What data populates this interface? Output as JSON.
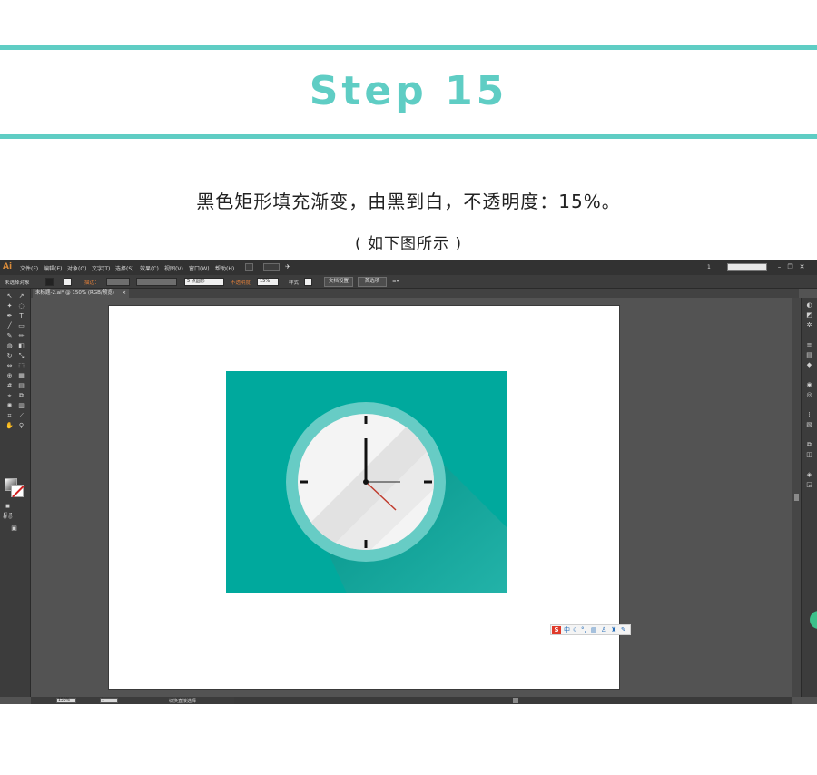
{
  "header": {
    "title": "Step 15",
    "description": "黑色矩形填充渐变，由黑到白，不透明度：15%。",
    "subtitle": "( 如下图所示 )"
  },
  "colors": {
    "accent": "#5fcdc4",
    "canvas_teal": "#00a99d",
    "clock_ring": "#67ccc5",
    "clock_face": "#f4f4f4",
    "second_hand": "#c0392b"
  },
  "app": {
    "logo": "Ai",
    "menu": [
      "文件(F)",
      "编辑(E)",
      "对象(O)",
      "文字(T)",
      "选择(S)",
      "效果(C)",
      "视图(V)",
      "窗口(W)",
      "帮助(H)"
    ],
    "workspace_label": "1",
    "control": {
      "selection_label": "未选择对象",
      "stroke_label": "描边：",
      "points_value": "5 点圆形",
      "opacity_label": "不透明度",
      "opacity_value": "15%",
      "style_label": "样式：",
      "doc_setup": "文档设置",
      "prefs": "首选项"
    },
    "document_tab": "未标题-2.ai* @ 150% (RGB/预览)",
    "status": {
      "zoom": "150%",
      "page": "1",
      "tool_hint": "切换直接选择"
    },
    "tools": [
      "selection-icon",
      "direct-selection-icon",
      "magic-wand-icon",
      "lasso-icon",
      "pen-icon",
      "type-icon",
      "line-icon",
      "rectangle-icon",
      "paintbrush-icon",
      "pencil-icon",
      "blob-brush-icon",
      "eraser-icon",
      "rotate-icon",
      "scale-icon",
      "width-icon",
      "free-transform-icon",
      "shape-builder-icon",
      "perspective-icon",
      "mesh-icon",
      "gradient-icon",
      "eyedropper-icon",
      "blend-icon",
      "symbol-sprayer-icon",
      "column-graph-icon",
      "artboard-icon",
      "slice-icon",
      "hand-icon",
      "zoom-icon"
    ],
    "panels": [
      "color-panel-icon",
      "color-guide-icon",
      "swatches-icon",
      "brushes-icon",
      "symbols-icon",
      "stroke-icon",
      "gradient-panel-icon",
      "transparency-icon",
      "appearance-icon",
      "graphic-styles-icon",
      "align-icon",
      "pathfinder-icon",
      "layers-icon",
      "artboards-icon"
    ]
  },
  "ime": {
    "logo": "S",
    "mode": "中"
  }
}
